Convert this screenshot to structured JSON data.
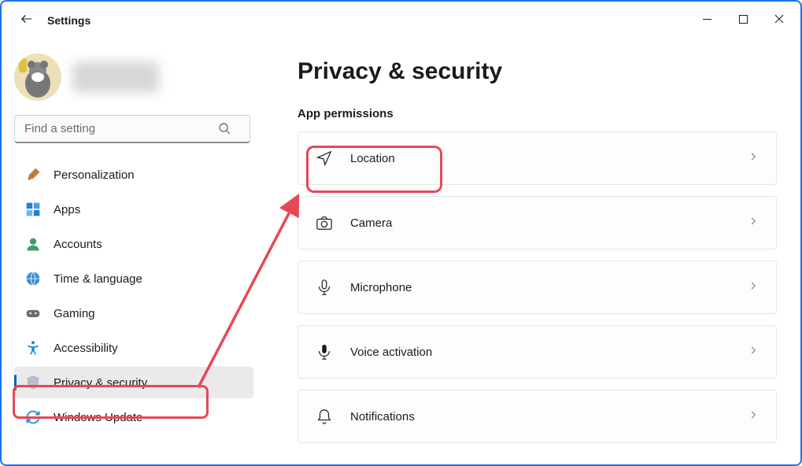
{
  "window": {
    "back_aria": "Back",
    "title": "Settings",
    "min_aria": "Minimize",
    "max_aria": "Maximize",
    "close_aria": "Close"
  },
  "search": {
    "placeholder": "Find a setting"
  },
  "sidebar": {
    "items": [
      {
        "icon": "personalization-icon",
        "label": "Personalization"
      },
      {
        "icon": "apps-icon",
        "label": "Apps"
      },
      {
        "icon": "accounts-icon",
        "label": "Accounts"
      },
      {
        "icon": "time-language-icon",
        "label": "Time & language"
      },
      {
        "icon": "gaming-icon",
        "label": "Gaming"
      },
      {
        "icon": "accessibility-icon",
        "label": "Accessibility"
      },
      {
        "icon": "privacy-security-icon",
        "label": "Privacy & security"
      },
      {
        "icon": "windows-update-icon",
        "label": "Windows Update"
      }
    ],
    "selected_index": 6
  },
  "main": {
    "page_title": "Privacy & security",
    "section_title": "App permissions",
    "cards": [
      {
        "icon": "location-icon",
        "label": "Location"
      },
      {
        "icon": "camera-icon",
        "label": "Camera"
      },
      {
        "icon": "microphone-icon",
        "label": "Microphone"
      },
      {
        "icon": "voice-activation-icon",
        "label": "Voice activation"
      },
      {
        "icon": "notifications-icon",
        "label": "Notifications"
      }
    ]
  },
  "annotation": {
    "highlight_color": "#e74856"
  }
}
